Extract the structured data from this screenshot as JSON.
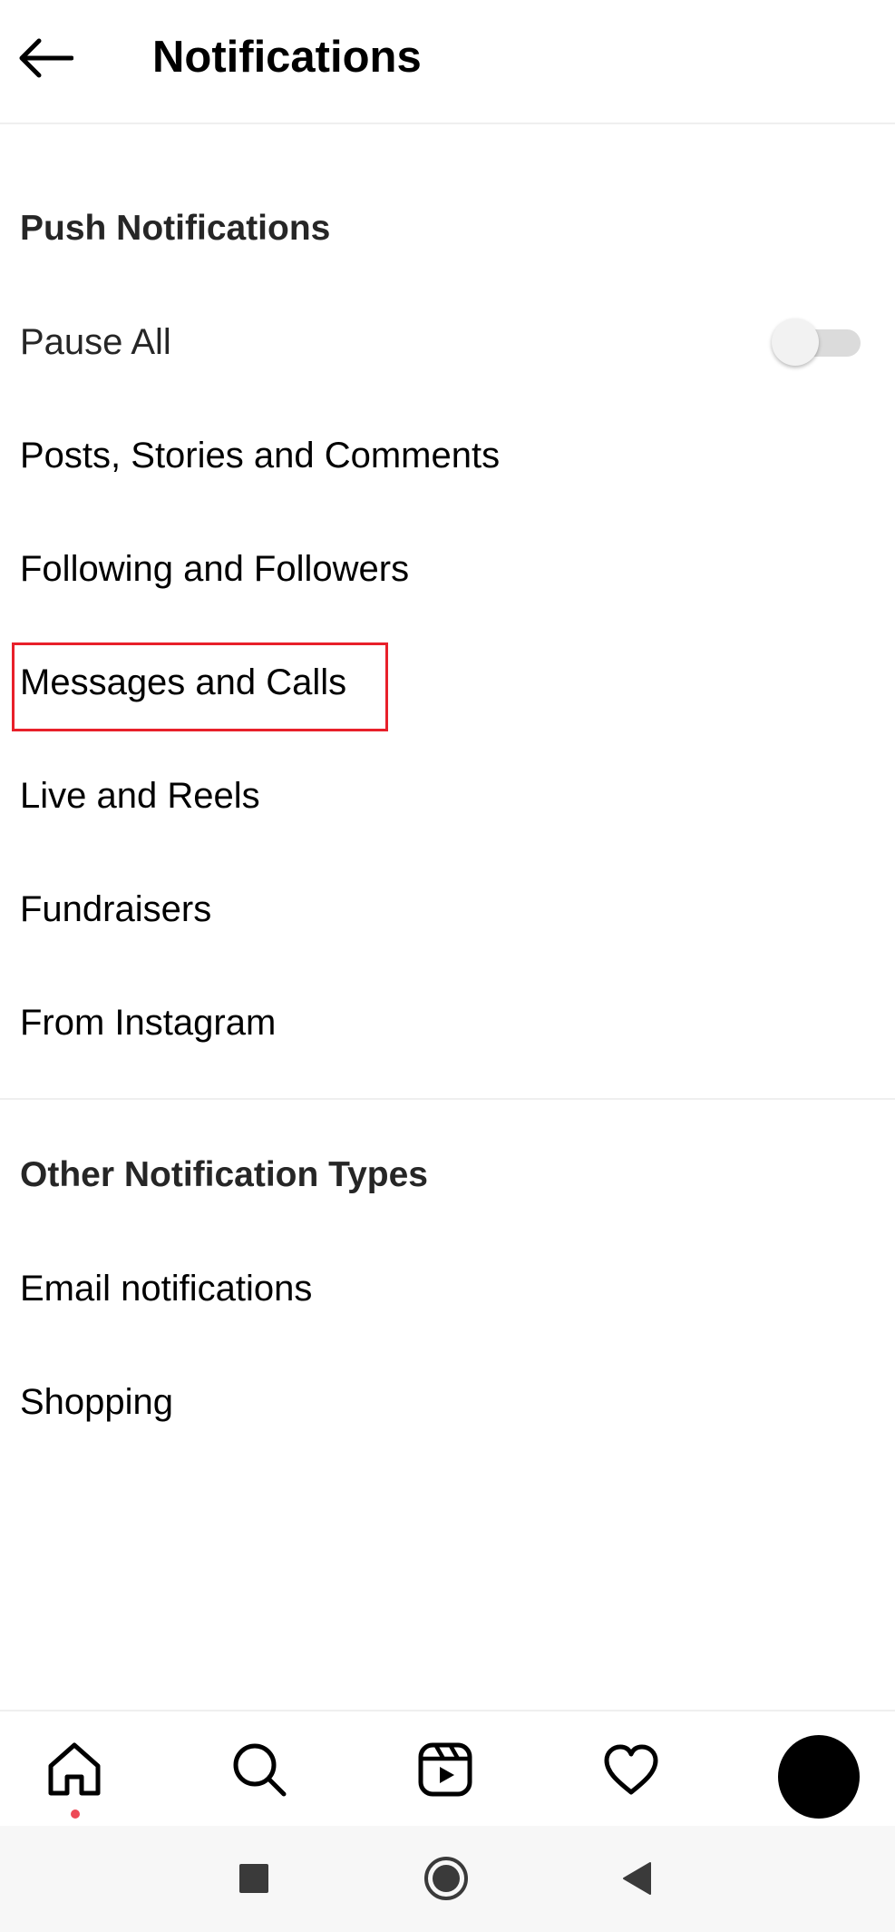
{
  "header": {
    "title": "Notifications",
    "back_icon": "arrow-left-icon"
  },
  "push_section": {
    "heading": "Push Notifications",
    "pause_all": {
      "label": "Pause All",
      "toggle_on": false
    },
    "items": [
      {
        "label": "Posts, Stories and Comments"
      },
      {
        "label": "Following and Followers"
      },
      {
        "label": "Messages and Calls",
        "highlighted": true
      },
      {
        "label": "Live and Reels"
      },
      {
        "label": "Fundraisers"
      },
      {
        "label": "From Instagram"
      }
    ]
  },
  "other_section": {
    "heading": "Other Notification Types",
    "items": [
      {
        "label": "Email notifications"
      },
      {
        "label": "Shopping"
      }
    ]
  },
  "bottom_nav": {
    "items": [
      {
        "icon": "home-icon",
        "active": true,
        "has_notification_dot": true
      },
      {
        "icon": "search-icon"
      },
      {
        "icon": "reels-icon"
      },
      {
        "icon": "heart-icon"
      },
      {
        "icon": "profile-avatar"
      }
    ]
  },
  "system_nav": {
    "items": [
      {
        "icon": "recents-square-icon"
      },
      {
        "icon": "home-circle-icon"
      },
      {
        "icon": "back-triangle-icon"
      }
    ]
  },
  "colors": {
    "highlight": "#e8202a",
    "notification_dot": "#ed4956",
    "divider": "#efefef",
    "toggle_track": "#dbdbdb"
  }
}
